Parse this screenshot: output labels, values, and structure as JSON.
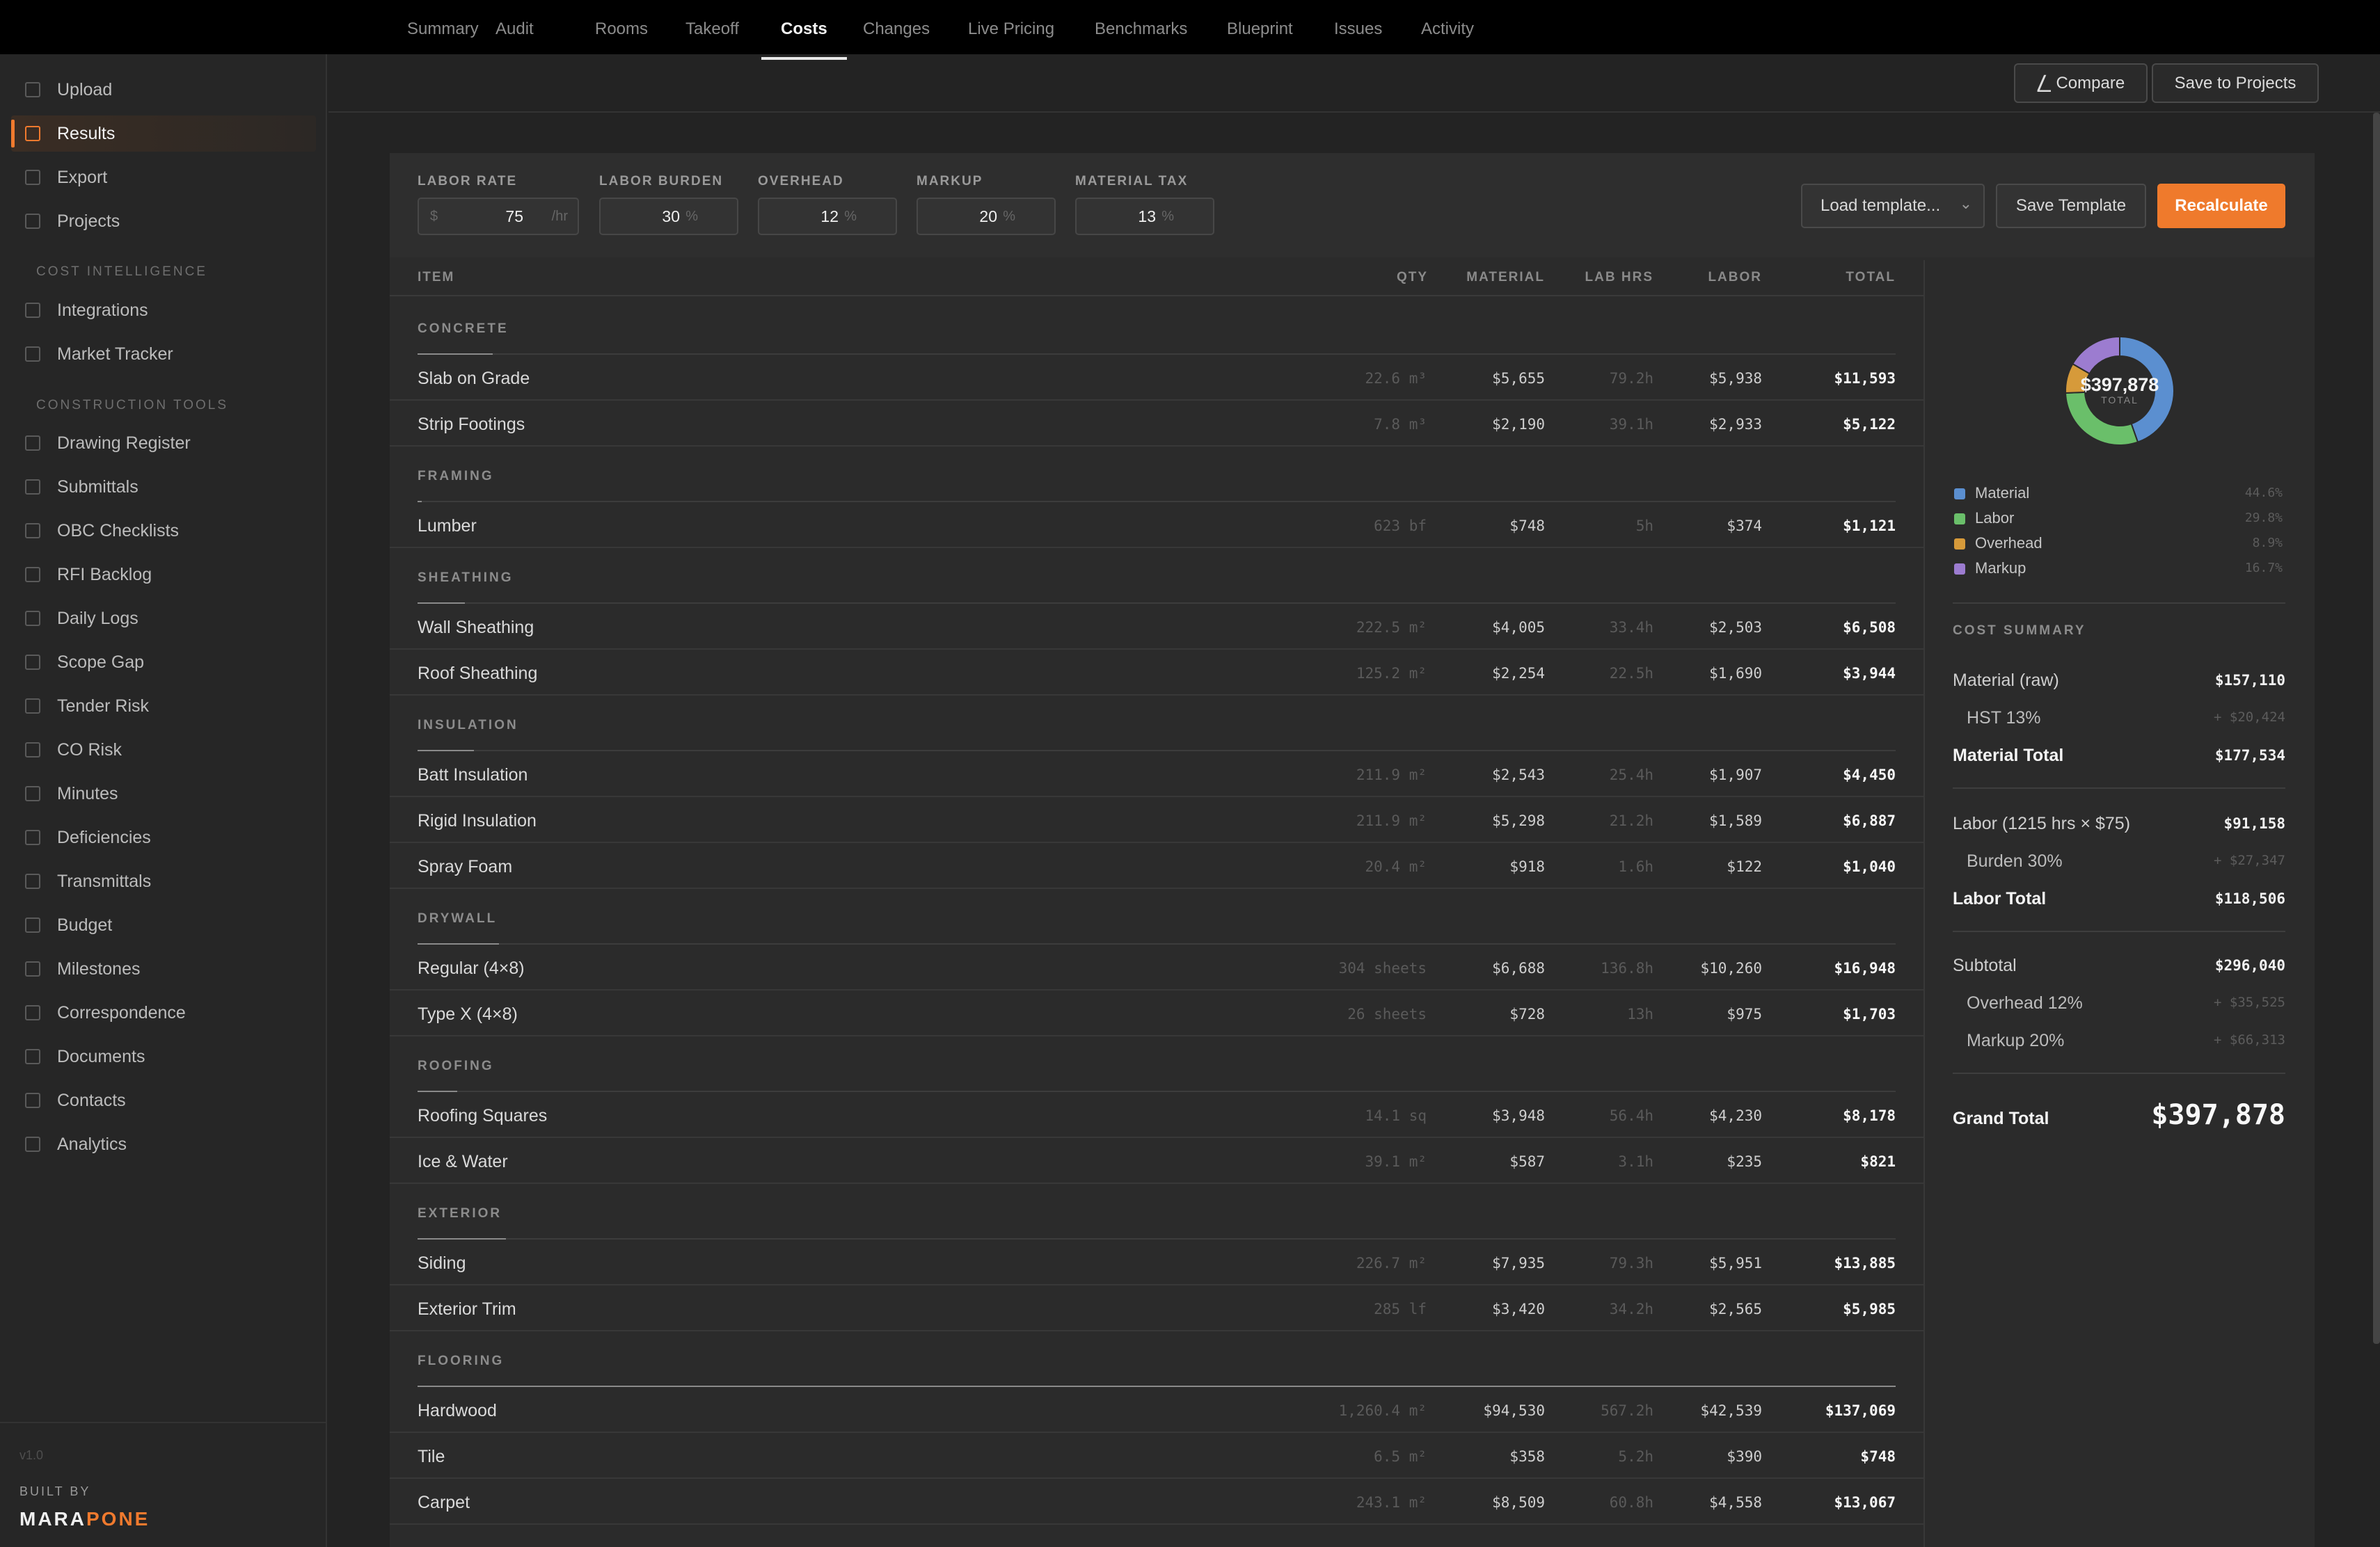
{
  "sidebar": {
    "main_items": [
      {
        "label": "Upload",
        "icon": "upload-icon"
      },
      {
        "label": "Results",
        "icon": "results-icon",
        "active": true
      },
      {
        "label": "Export",
        "icon": "export-icon"
      },
      {
        "label": "Projects",
        "icon": "projects-icon"
      }
    ],
    "section_cost": "COST INTELLIGENCE",
    "cost_items": [
      {
        "label": "Integrations",
        "icon": "integrations-icon"
      },
      {
        "label": "Market Tracker",
        "icon": "market-tracker-icon"
      }
    ],
    "section_tools": "CONSTRUCTION TOOLS",
    "tool_items": [
      {
        "label": "Drawing Register"
      },
      {
        "label": "Submittals"
      },
      {
        "label": "OBC Checklists"
      },
      {
        "label": "RFI Backlog"
      },
      {
        "label": "Daily Logs"
      },
      {
        "label": "Scope Gap"
      },
      {
        "label": "Tender Risk"
      },
      {
        "label": "CO Risk"
      },
      {
        "label": "Minutes"
      },
      {
        "label": "Deficiencies"
      },
      {
        "label": "Transmittals"
      },
      {
        "label": "Budget"
      },
      {
        "label": "Milestones"
      },
      {
        "label": "Correspondence"
      },
      {
        "label": "Documents"
      },
      {
        "label": "Contacts"
      },
      {
        "label": "Analytics"
      }
    ],
    "version": "v1.0",
    "built_by": "BUILT BY",
    "brand_a": "MARA",
    "brand_b": "PONE"
  },
  "tabs": [
    "Summary",
    "Audit",
    "Rooms",
    "Takeoff",
    "Costs",
    "Changes",
    "Live Pricing",
    "Benchmarks",
    "Blueprint",
    "Issues",
    "Activity"
  ],
  "active_tab": "Costs",
  "header_buttons": {
    "compare": "⎳ Compare",
    "save": "Save to Projects"
  },
  "controls": {
    "labor_rate": {
      "label": "LABOR RATE",
      "prefix": "$",
      "value": "75",
      "suffix": "/hr"
    },
    "labor_burden": {
      "label": "LABOR BURDEN",
      "value": "30",
      "suffix": "%"
    },
    "overhead": {
      "label": "OVERHEAD",
      "value": "12",
      "suffix": "%"
    },
    "markup": {
      "label": "MARKUP",
      "value": "20",
      "suffix": "%"
    },
    "material_tax": {
      "label": "MATERIAL TAX",
      "value": "13",
      "suffix": "%"
    },
    "template_select": "Load template...",
    "save_template": "Save Template",
    "recalculate": "Recalculate"
  },
  "table": {
    "headers": {
      "item": "ITEM",
      "qty": "QTY",
      "material": "MATERIAL",
      "lab_hrs": "LAB HRS",
      "labor": "LABOR",
      "total": "TOTAL"
    },
    "sections": [
      {
        "category": "CONCRETE",
        "share": 0.051,
        "rows": [
          {
            "item": "Slab on Grade",
            "qty": "22.6 m³",
            "material": "$5,655",
            "lab_hrs": "79.2h",
            "labor": "$5,938",
            "total": "$11,593"
          },
          {
            "item": "Strip Footings",
            "qty": "7.8 m³",
            "material": "$2,190",
            "lab_hrs": "39.1h",
            "labor": "$2,933",
            "total": "$5,122"
          }
        ]
      },
      {
        "category": "FRAMING",
        "share": 0.003,
        "rows": [
          {
            "item": "Lumber",
            "qty": "623 bf",
            "material": "$748",
            "lab_hrs": "5h",
            "labor": "$374",
            "total": "$1,121"
          }
        ]
      },
      {
        "category": "SHEATHING",
        "share": 0.032,
        "rows": [
          {
            "item": "Wall Sheathing",
            "qty": "222.5 m²",
            "material": "$4,005",
            "lab_hrs": "33.4h",
            "labor": "$2,503",
            "total": "$6,508"
          },
          {
            "item": "Roof Sheathing",
            "qty": "125.2 m²",
            "material": "$2,254",
            "lab_hrs": "22.5h",
            "labor": "$1,690",
            "total": "$3,944"
          }
        ]
      },
      {
        "category": "INSULATION",
        "share": 0.038,
        "rows": [
          {
            "item": "Batt Insulation",
            "qty": "211.9 m²",
            "material": "$2,543",
            "lab_hrs": "25.4h",
            "labor": "$1,907",
            "total": "$4,450"
          },
          {
            "item": "Rigid Insulation",
            "qty": "211.9 m²",
            "material": "$5,298",
            "lab_hrs": "21.2h",
            "labor": "$1,589",
            "total": "$6,887"
          },
          {
            "item": "Spray Foam",
            "qty": "20.4 m²",
            "material": "$918",
            "lab_hrs": "1.6h",
            "labor": "$122",
            "total": "$1,040"
          }
        ]
      },
      {
        "category": "DRYWALL",
        "share": 0.055,
        "rows": [
          {
            "item": "Regular (4×8)",
            "qty": "304 sheets",
            "material": "$6,688",
            "lab_hrs": "136.8h",
            "labor": "$10,260",
            "total": "$16,948"
          },
          {
            "item": "Type X (4×8)",
            "qty": "26 sheets",
            "material": "$728",
            "lab_hrs": "13h",
            "labor": "$975",
            "total": "$1,703"
          }
        ]
      },
      {
        "category": "ROOFING",
        "share": 0.027,
        "rows": [
          {
            "item": "Roofing Squares",
            "qty": "14.1 sq",
            "material": "$3,948",
            "lab_hrs": "56.4h",
            "labor": "$4,230",
            "total": "$8,178"
          },
          {
            "item": "Ice & Water",
            "qty": "39.1 m²",
            "material": "$587",
            "lab_hrs": "3.1h",
            "labor": "$235",
            "total": "$821"
          }
        ]
      },
      {
        "category": "EXTERIOR",
        "share": 0.06,
        "rows": [
          {
            "item": "Siding",
            "qty": "226.7 m²",
            "material": "$7,935",
            "lab_hrs": "79.3h",
            "labor": "$5,951",
            "total": "$13,885"
          },
          {
            "item": "Exterior Trim",
            "qty": "285 lf",
            "material": "$3,420",
            "lab_hrs": "34.2h",
            "labor": "$2,565",
            "total": "$5,985"
          }
        ]
      },
      {
        "category": "FLOORING",
        "share": 1.0,
        "rows": [
          {
            "item": "Hardwood",
            "qty": "1,260.4 m²",
            "material": "$94,530",
            "lab_hrs": "567.2h",
            "labor": "$42,539",
            "total": "$137,069"
          },
          {
            "item": "Tile",
            "qty": "6.5 m²",
            "material": "$358",
            "lab_hrs": "5.2h",
            "labor": "$390",
            "total": "$748"
          },
          {
            "item": "Carpet",
            "qty": "243.1 m²",
            "material": "$8,509",
            "lab_hrs": "60.8h",
            "labor": "$4,558",
            "total": "$13,067"
          }
        ]
      }
    ]
  },
  "donut": {
    "center_value": "$397,878",
    "center_label": "TOTAL",
    "segments": [
      {
        "name": "Material",
        "pct": "44.6%",
        "value": 44.6,
        "color": "#5b8fd0"
      },
      {
        "name": "Labor",
        "pct": "29.8%",
        "value": 29.8,
        "color": "#6abf6a"
      },
      {
        "name": "Overhead",
        "pct": "8.9%",
        "value": 8.9,
        "color": "#d69a3a"
      },
      {
        "name": "Markup",
        "pct": "16.7%",
        "value": 16.7,
        "color": "#9c7cd0"
      }
    ]
  },
  "summary": {
    "heading": "COST SUMMARY",
    "material_raw": {
      "label": "Material (raw)",
      "value": "$157,110"
    },
    "hst": {
      "label": "HST 13%",
      "value": "+ $20,424"
    },
    "material_total": {
      "label": "Material Total",
      "value": "$177,534"
    },
    "labor": {
      "label": "Labor (1215 hrs × $75)",
      "value": "$91,158"
    },
    "burden": {
      "label": "Burden 30%",
      "value": "+ $27,347"
    },
    "labor_total": {
      "label": "Labor Total",
      "value": "$118,506"
    },
    "subtotal": {
      "label": "Subtotal",
      "value": "$296,040"
    },
    "overhead": {
      "label": "Overhead 12%",
      "value": "+ $35,525"
    },
    "markup": {
      "label": "Markup 20%",
      "value": "+ $66,313"
    },
    "grand": {
      "label": "Grand Total",
      "value": "$397,878"
    }
  }
}
